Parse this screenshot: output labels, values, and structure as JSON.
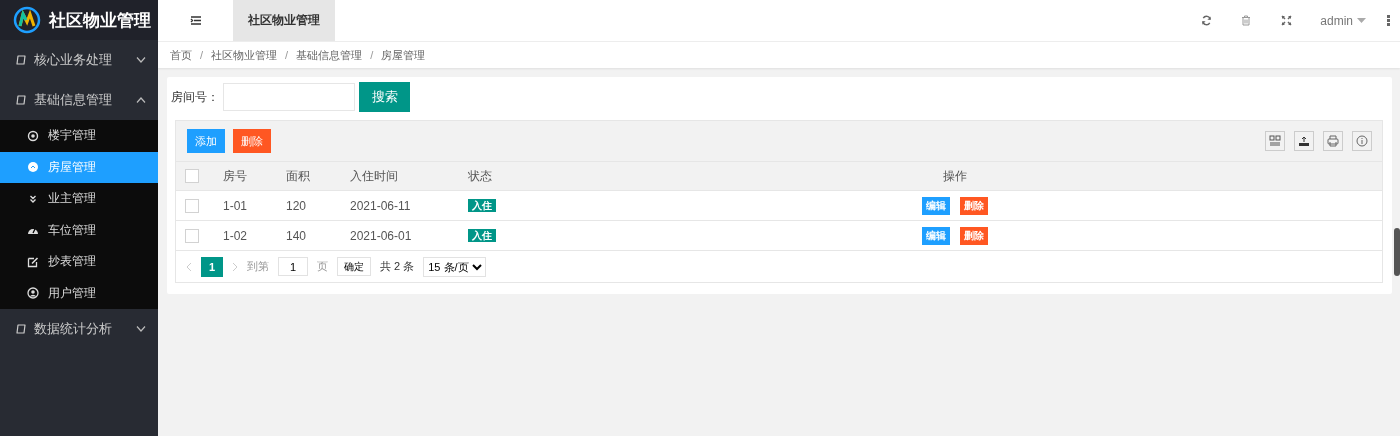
{
  "sidebar": {
    "logo_text": "社区物业管理",
    "menu": [
      {
        "label": "核心业务处理",
        "expanded": false
      },
      {
        "label": "基础信息管理",
        "expanded": true,
        "children": [
          {
            "label": "楼宇管理",
            "selected": false
          },
          {
            "label": "房屋管理",
            "selected": true
          },
          {
            "label": "业主管理",
            "selected": false
          },
          {
            "label": "车位管理",
            "selected": false
          },
          {
            "label": "抄表管理",
            "selected": false
          },
          {
            "label": "用户管理",
            "selected": false
          }
        ]
      },
      {
        "label": "数据统计分析",
        "expanded": false
      }
    ]
  },
  "header": {
    "tabs": [
      {
        "label": "社区物业管理",
        "selected": true
      }
    ],
    "user": "admin"
  },
  "breadcrumb": [
    {
      "label": "首页"
    },
    {
      "separator": "/",
      "label": "社区物业管理"
    },
    {
      "separator": "/",
      "label": "基础信息管理"
    },
    {
      "separator": "/",
      "label": "房屋管理"
    }
  ],
  "search": {
    "label": "房间号：",
    "button": "搜索"
  },
  "toolbar": {
    "buttons": [
      {
        "label": "添加",
        "kind": "primary"
      },
      {
        "label": "删除",
        "kind": "danger"
      }
    ]
  },
  "table": {
    "all_checked": false,
    "columns": [
      "房号",
      "面积",
      "入住时间",
      "状态",
      "操作"
    ],
    "rows": [
      {
        "checked": false,
        "cells": [
          "1-01",
          "120",
          "2021-06-11"
        ],
        "status": "入住",
        "actions": [
          "编辑",
          "删除"
        ]
      },
      {
        "checked": false,
        "cells": [
          "1-02",
          "140",
          "2021-06-01"
        ],
        "status": "入住",
        "actions": [
          "编辑",
          "删除"
        ]
      }
    ]
  },
  "pagination": {
    "current": "1",
    "goto_label": "到第",
    "goto_value": "1",
    "page_unit": "页",
    "confirm": "确定",
    "total": "共 2 条",
    "page_size": "15 条/页"
  }
}
